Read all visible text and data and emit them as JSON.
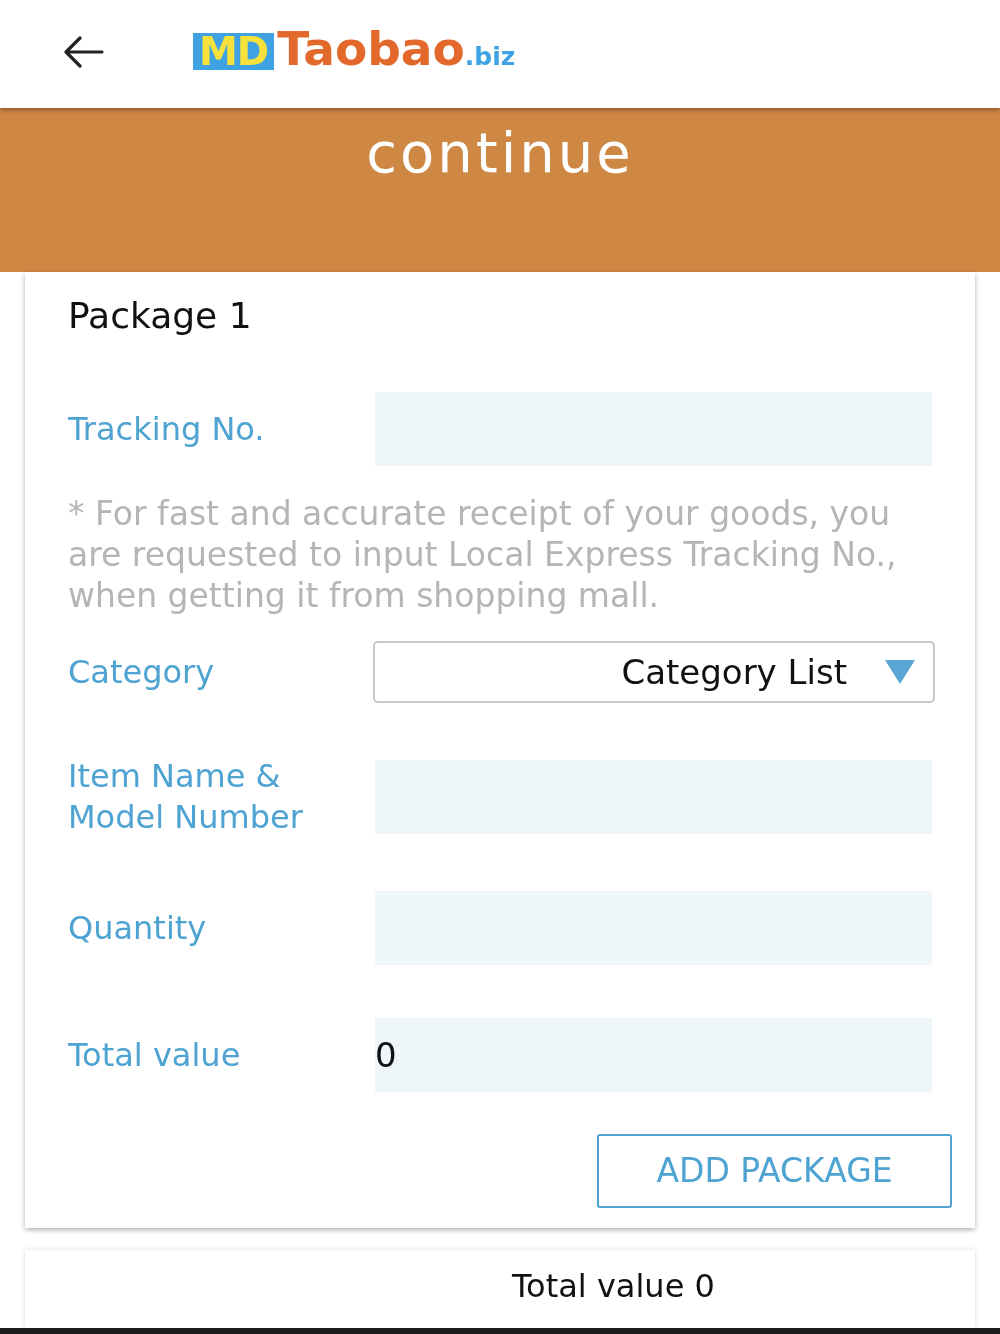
{
  "header": {
    "logo": {
      "badge": "MD",
      "name": "Taobao",
      "suffix": ".biz"
    }
  },
  "banner": {
    "text": "continue"
  },
  "package": {
    "title": "Package 1",
    "fields": [
      {
        "kind": "input",
        "label": "Tracking No."
      },
      {
        "kind": "note",
        "text": "* For fast and accurate receipt of your goods, you are requested to input Local Express Tracking No., when getting it from shopping mall."
      },
      {
        "kind": "select",
        "label": "Category",
        "value": "Category List"
      },
      {
        "kind": "input",
        "label": "Item Name & Model Number"
      },
      {
        "kind": "input",
        "label": "Quantity"
      },
      {
        "kind": "input",
        "label": "Total value",
        "value": "0"
      }
    ],
    "add_button": "ADD PACKAGE"
  },
  "summary": {
    "text": "Total value 0"
  }
}
